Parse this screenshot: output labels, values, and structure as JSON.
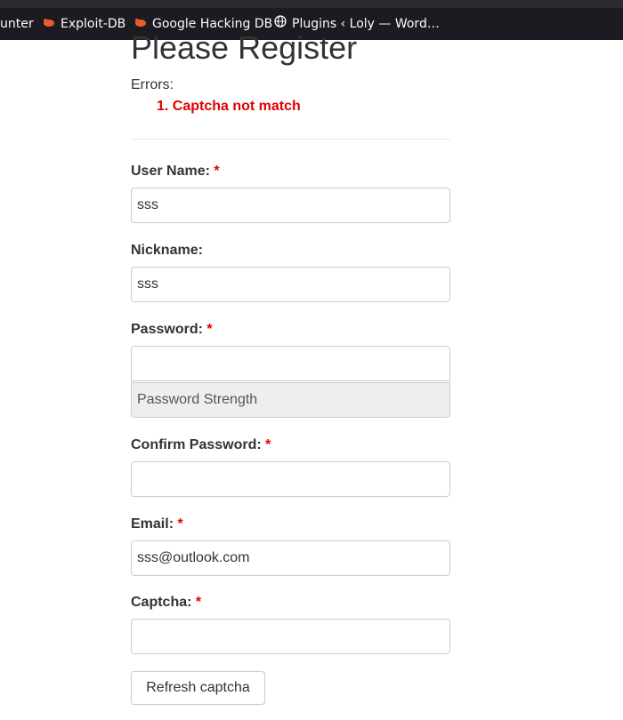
{
  "bookmarks": [
    {
      "label": "unter",
      "icon": "none"
    },
    {
      "label": "Exploit-DB",
      "icon": "exploit-db-bug-icon"
    },
    {
      "label": "Google Hacking DB",
      "icon": "exploit-db-bug-icon"
    },
    {
      "label": "Plugins ‹ Loly — Word…",
      "icon": "globe-icon"
    }
  ],
  "colors": {
    "accent": "#e00000",
    "bookmark_bar": "#1c1b22",
    "bug": "#ec5b2a"
  },
  "form": {
    "title": "Please Register",
    "errors_label": "Errors:",
    "errors": [
      "1. Captcha not match"
    ],
    "required_mark": "*",
    "username": {
      "label": "User Name:",
      "value": "sss"
    },
    "nickname": {
      "label": "Nickname:",
      "value": "sss"
    },
    "password": {
      "label": "Password:",
      "value": "",
      "strength_text": "Password Strength"
    },
    "confirm_password": {
      "label": "Confirm Password:",
      "value": ""
    },
    "email": {
      "label": "Email:",
      "value": "sss@outlook.com"
    },
    "captcha": {
      "label": "Captcha:",
      "value": ""
    },
    "refresh_captcha_label": "Refresh captcha"
  }
}
